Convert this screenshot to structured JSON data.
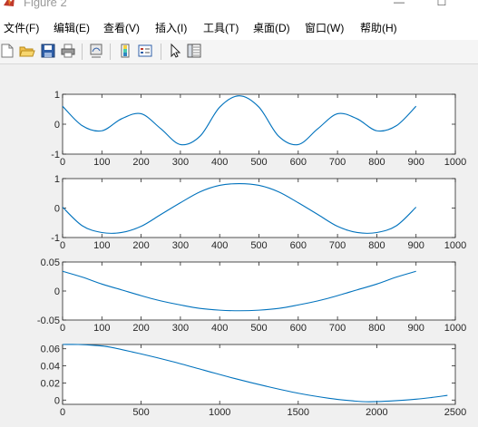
{
  "window": {
    "title": "Figure 2",
    "minimize_glyph": "—",
    "maximize_glyph": "☐"
  },
  "menubar": {
    "items": [
      "文件(F)",
      "编辑(E)",
      "查看(V)",
      "插入(I)",
      "工具(T)",
      "桌面(D)",
      "窗口(W)",
      "帮助(H)"
    ]
  },
  "toolbar": {
    "icons": [
      "new-figure-icon",
      "open-file-icon",
      "save-icon",
      "print-icon",
      "link-plot-icon",
      "colorbar-icon",
      "legend-icon",
      "pointer-icon",
      "property-inspector-icon"
    ]
  },
  "colors": {
    "line": "#0072bd",
    "axes": "#262626"
  },
  "chart_data": [
    {
      "type": "line",
      "x_step": 1,
      "xlim": [
        0,
        1000
      ],
      "ylim": [
        -1,
        1
      ],
      "xticks": [
        0,
        100,
        200,
        300,
        400,
        500,
        600,
        700,
        800,
        900,
        1000
      ],
      "yticks": [
        -1,
        0,
        1
      ],
      "x": [
        0,
        50,
        100,
        150,
        200,
        250,
        300,
        350,
        400,
        450,
        500,
        550,
        600,
        650,
        700,
        750,
        800,
        850,
        900
      ],
      "y": [
        0.6,
        -0.05,
        -0.22,
        0.18,
        0.35,
        -0.15,
        -0.68,
        -0.4,
        0.57,
        0.95,
        0.57,
        -0.4,
        -0.68,
        -0.15,
        0.35,
        0.18,
        -0.22,
        -0.05,
        0.6
      ]
    },
    {
      "type": "line",
      "xlim": [
        0,
        1000
      ],
      "ylim": [
        -1,
        1
      ],
      "xticks": [
        0,
        100,
        200,
        300,
        400,
        500,
        600,
        700,
        800,
        900,
        1000
      ],
      "yticks": [
        -1,
        0,
        1
      ],
      "x": [
        0,
        50,
        100,
        150,
        200,
        250,
        300,
        350,
        400,
        450,
        500,
        550,
        600,
        650,
        700,
        750,
        800,
        850,
        900
      ],
      "y": [
        0.03,
        -0.6,
        -0.83,
        -0.83,
        -0.62,
        -0.22,
        0.18,
        0.55,
        0.77,
        0.83,
        0.77,
        0.55,
        0.18,
        -0.22,
        -0.62,
        -0.83,
        -0.83,
        -0.6,
        0.03
      ]
    },
    {
      "type": "line",
      "xlim": [
        0,
        1000
      ],
      "ylim": [
        -0.05,
        0.05
      ],
      "xticks": [
        0,
        100,
        200,
        300,
        400,
        500,
        600,
        700,
        800,
        900,
        1000
      ],
      "yticks": [
        -0.05,
        0,
        0.05
      ],
      "x": [
        0,
        50,
        100,
        150,
        200,
        250,
        300,
        350,
        400,
        450,
        500,
        550,
        600,
        650,
        700,
        750,
        800,
        850,
        900
      ],
      "y": [
        0.034,
        0.024,
        0.012,
        0.002,
        -0.008,
        -0.017,
        -0.024,
        -0.03,
        -0.033,
        -0.034,
        -0.033,
        -0.03,
        -0.024,
        -0.017,
        -0.008,
        0.002,
        0.012,
        0.024,
        0.034
      ]
    },
    {
      "type": "line",
      "xlim": [
        0,
        2500
      ],
      "ylim": [
        -0.005,
        0.065
      ],
      "xticks": [
        0,
        500,
        1000,
        1500,
        2000,
        2500
      ],
      "yticks": [
        0,
        0.02,
        0.04,
        0.06
      ],
      "x": [
        0,
        100,
        200,
        300,
        500,
        700,
        900,
        1100,
        1300,
        1500,
        1700,
        1850,
        1950,
        2100,
        2250,
        2350,
        2450
      ],
      "y": [
        0.065,
        0.065,
        0.064,
        0.062,
        0.054,
        0.045,
        0.035,
        0.025,
        0.016,
        0.008,
        0.002,
        -0.001,
        -0.002,
        -0.001,
        0.001,
        0.003,
        0.0055
      ]
    }
  ]
}
